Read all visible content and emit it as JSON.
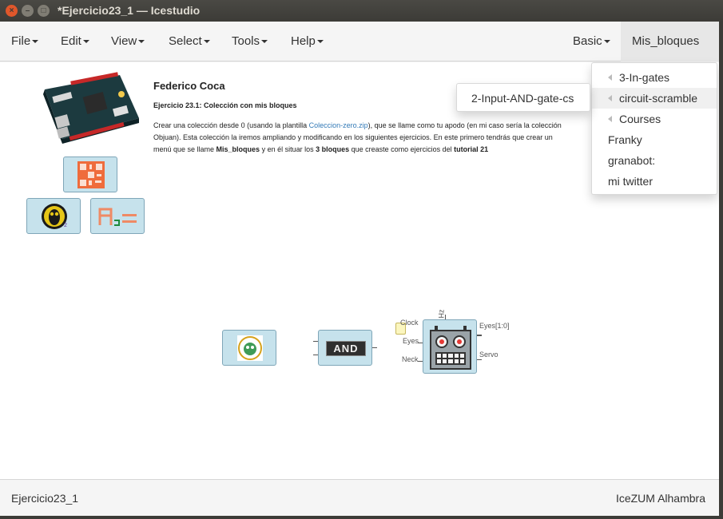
{
  "window": {
    "title": "*Ejercicio23_1 — Icestudio",
    "close_glyph": "×",
    "min_glyph": "–",
    "max_glyph": "□"
  },
  "menubar": {
    "left": [
      "File",
      "Edit",
      "View",
      "Select",
      "Tools",
      "Help"
    ],
    "right": [
      "Basic",
      "Mis_bloques"
    ]
  },
  "dropdown": {
    "items": [
      {
        "label": "3-In-gates",
        "has_submenu": true
      },
      {
        "label": "circuit-scramble",
        "has_submenu": true
      },
      {
        "label": "Courses",
        "has_submenu": true
      },
      {
        "label": "Franky",
        "has_submenu": false
      },
      {
        "label": "granabot:",
        "has_submenu": false
      },
      {
        "label": "mi twitter",
        "has_submenu": false
      }
    ],
    "submenu_item": "2-Input-AND-gate-cs"
  },
  "info": {
    "author": "Federico Coca",
    "subtitle": "Ejercicio 23.1: Colección con mis bloques",
    "p1_a": "Crear una colección desde 0 (usando la plantilla ",
    "p1_link": "Coleccion-zero.zip",
    "p1_b": "), que se llame como tu apodo (en mi caso sería la colección Objuan). Esta colección la iremos ampliando y modificando en los siguientes ejercicios. En este primero tendrás que crear un menú que se llame ",
    "p1_bold1": "Mis_bloques",
    "p1_c": " y en él situar los ",
    "p1_bold2": "3 bloques",
    "p1_d": " que creaste como ejercicios del ",
    "p1_bold3": "tutorial 21"
  },
  "blocks": {
    "and_label": "AND",
    "robot_ports_left": [
      "Clock",
      "Eyes",
      "Neck"
    ],
    "robot_ports_right": [
      "Eyes[1:0]",
      "Servo"
    ],
    "robot_top_port": "Hz",
    "badge_sub": "2"
  },
  "status": {
    "left": "Ejercicio23_1",
    "right": "IceZUM Alhambra"
  },
  "colors": {
    "block_fill": "#c6e2ec",
    "block_border": "#7fa6b8",
    "link": "#337ab7",
    "titlebar": "#3c3b37"
  }
}
